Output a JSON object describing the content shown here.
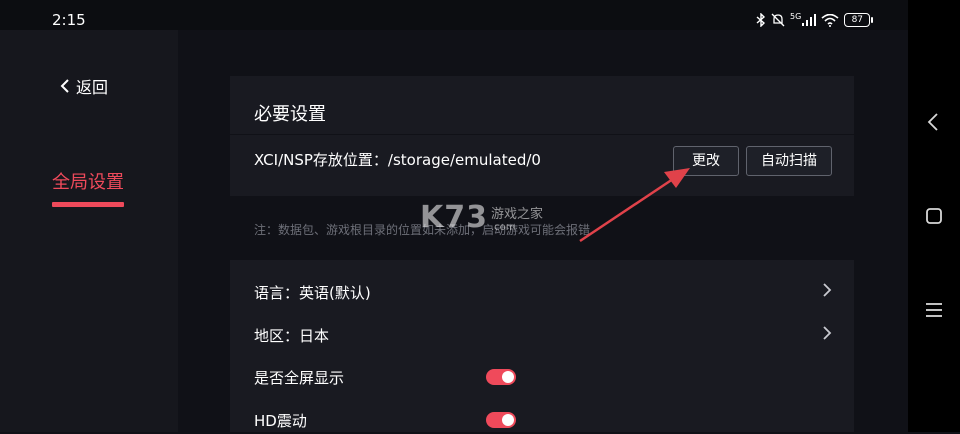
{
  "status_bar": {
    "time": "2:15",
    "network": "5G",
    "battery": "87"
  },
  "sidebar": {
    "back_label": "返回",
    "active_item": "全局设置"
  },
  "storage_card": {
    "title": "必要设置",
    "path_label": "XCI/NSP存放位置：/storage/emulated/0",
    "change_button": "更改",
    "scan_button": "自动扫描"
  },
  "note": "注：数据包、游戏根目录的位置如未添加，启动游戏可能会报错",
  "settings": {
    "language": "语言：英语(默认)",
    "region": "地区：日本",
    "fullscreen": {
      "label": "是否全屏显示",
      "enabled": true
    },
    "hd_rumble": {
      "label": "HD震动",
      "enabled": true
    }
  },
  "watermark": {
    "logo": "K73",
    "text": "游戏之家",
    "sub": ".com"
  },
  "colors": {
    "accent": "#ef4a5b",
    "background": "#101117",
    "panel": "#191a21",
    "annotation_arrow": "#e0424a"
  },
  "icons": [
    "back-chevron-icon",
    "chevron-right-icon",
    "bluetooth-icon",
    "mute-icon",
    "signal-icon",
    "wifi-icon",
    "battery-icon",
    "nav-back-icon",
    "nav-home-icon",
    "nav-menu-icon"
  ]
}
